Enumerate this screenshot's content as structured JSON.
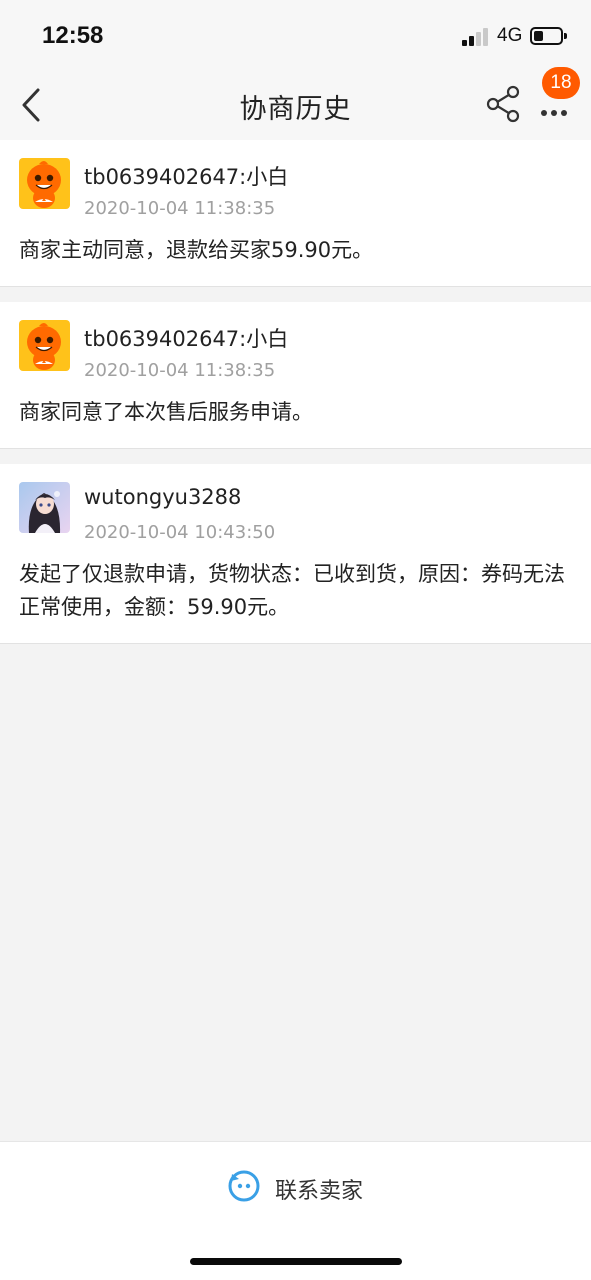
{
  "status_bar": {
    "time": "12:58",
    "network": "4G",
    "signal_bars_active": 2
  },
  "nav": {
    "title": "协商历史",
    "badge_count": "18"
  },
  "records": [
    {
      "name": "tb0639402647:小白",
      "timestamp": "2020-10-04 11:38:35",
      "message": "商家主动同意，退款给买家59.90元。",
      "avatar": "orange-mascot-icon"
    },
    {
      "name": "tb0639402647:小白",
      "timestamp": "2020-10-04 11:38:35",
      "message": "商家同意了本次售后服务申请。",
      "avatar": "orange-mascot-icon"
    },
    {
      "name": "wutongyu3288",
      "timestamp": "2020-10-04 10:43:50",
      "message": "发起了仅退款申请，货物状态：已收到货，原因：券码无法正常使用，金额：59.90元。",
      "avatar": "anime-girl-avatar"
    }
  ],
  "bottom": {
    "contact_label": "联系卖家"
  },
  "colors": {
    "accent": "#ff5a00",
    "mascot": "#ff6a00",
    "mascot_bg": "#ffc21a",
    "contact_icon": "#3aa0e6",
    "timestamp": "#a0a0a0"
  }
}
